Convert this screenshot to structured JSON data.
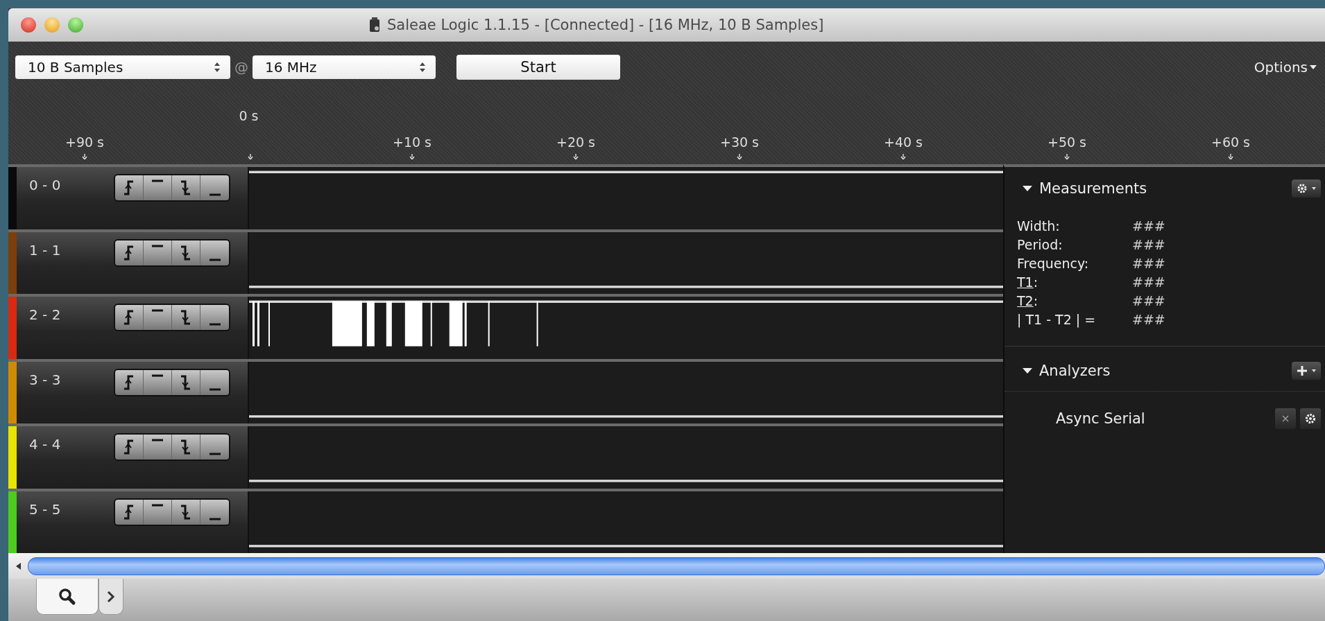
{
  "window": {
    "title": "Saleae Logic 1.1.15 - [Connected] - [16 MHz, 10 B Samples]"
  },
  "toolbar": {
    "samples": "10 B Samples",
    "at": "@",
    "rate": "16 MHz",
    "start": "Start",
    "options": "Options"
  },
  "ruler": {
    "origin": "0 s",
    "ticks": [
      "+90 s",
      "+10 s",
      "+20 s",
      "+30 s",
      "+40 s",
      "+50 s",
      "+60 s"
    ]
  },
  "channels": [
    {
      "label": "0 - 0",
      "color": "#0a0a0a",
      "kind": "constant",
      "high": true
    },
    {
      "label": "1 - 1",
      "color": "#7a3f0c",
      "kind": "constant",
      "high": false
    },
    {
      "label": "2 - 2",
      "color": "#d82a10",
      "kind": "activity",
      "high": true
    },
    {
      "label": "3 - 3",
      "color": "#d08a00",
      "kind": "constant",
      "high": false
    },
    {
      "label": "4 - 4",
      "color": "#e8e400",
      "kind": "constant",
      "high": false
    },
    {
      "label": "5 - 5",
      "color": "#4ccc1e",
      "kind": "constant",
      "high": false
    }
  ],
  "measurements": {
    "title": "Measurements",
    "expanded": true,
    "rows": [
      {
        "label": "Width:",
        "underlined": false,
        "value": "###"
      },
      {
        "label": "Period:",
        "underlined": false,
        "value": "###"
      },
      {
        "label": "Frequency:",
        "underlined": false,
        "value": "###"
      },
      {
        "label": "T1",
        "underlined": true,
        "after": ":",
        "value": "###"
      },
      {
        "label": "T2",
        "underlined": true,
        "after": ":",
        "value": "###"
      },
      {
        "label": "| T1 - T2 | =",
        "underlined": false,
        "value": "###"
      }
    ]
  },
  "analyzers": {
    "title": "Analyzers",
    "expanded": true,
    "items": [
      "Async Serial"
    ]
  },
  "bottom_tabs": [
    {
      "kind": "search",
      "selected": true
    },
    {
      "kind": "console",
      "selected": false
    }
  ]
}
